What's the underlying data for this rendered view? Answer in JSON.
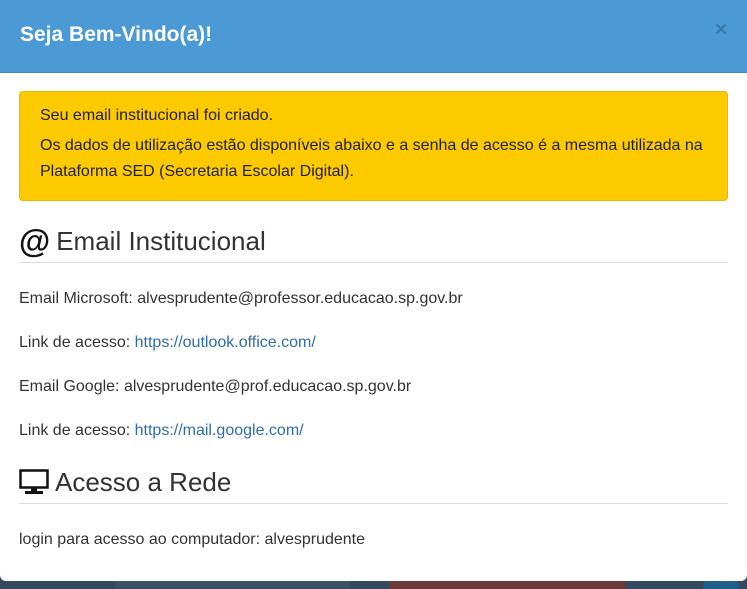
{
  "modal": {
    "title": "Seja Bem-Vindo(a)!",
    "close_label": "×"
  },
  "alert": {
    "line1": "Seu email institucional foi criado.",
    "line2": "Os dados de utilização estão disponíveis abaixo e a senha de acesso é a mesma utilizada na Plataforma SED (Secretaria Escolar Digital)."
  },
  "email_section": {
    "icon": "at-icon",
    "icon_glyph": "@",
    "title": "Email Institucional",
    "microsoft_label": "Email Microsoft: ",
    "microsoft_value": "alvesprudente@professor.educacao.sp.gov.br",
    "microsoft_link_label": "Link de acesso: ",
    "microsoft_link": "https://outlook.office.com/",
    "google_label": "Email Google: ",
    "google_value": "alvesprudente@prof.educacao.sp.gov.br",
    "google_link_label": "Link de acesso: ",
    "google_link": "https://mail.google.com/"
  },
  "network_section": {
    "icon": "monitor-icon",
    "title": "Acesso a Rede",
    "login_label": "login para acesso ao computador: ",
    "login_value": "alvesprudente"
  },
  "colors": {
    "header": "#4b9ad6",
    "alert": "#fdca00",
    "link": "#2f6ea7"
  }
}
